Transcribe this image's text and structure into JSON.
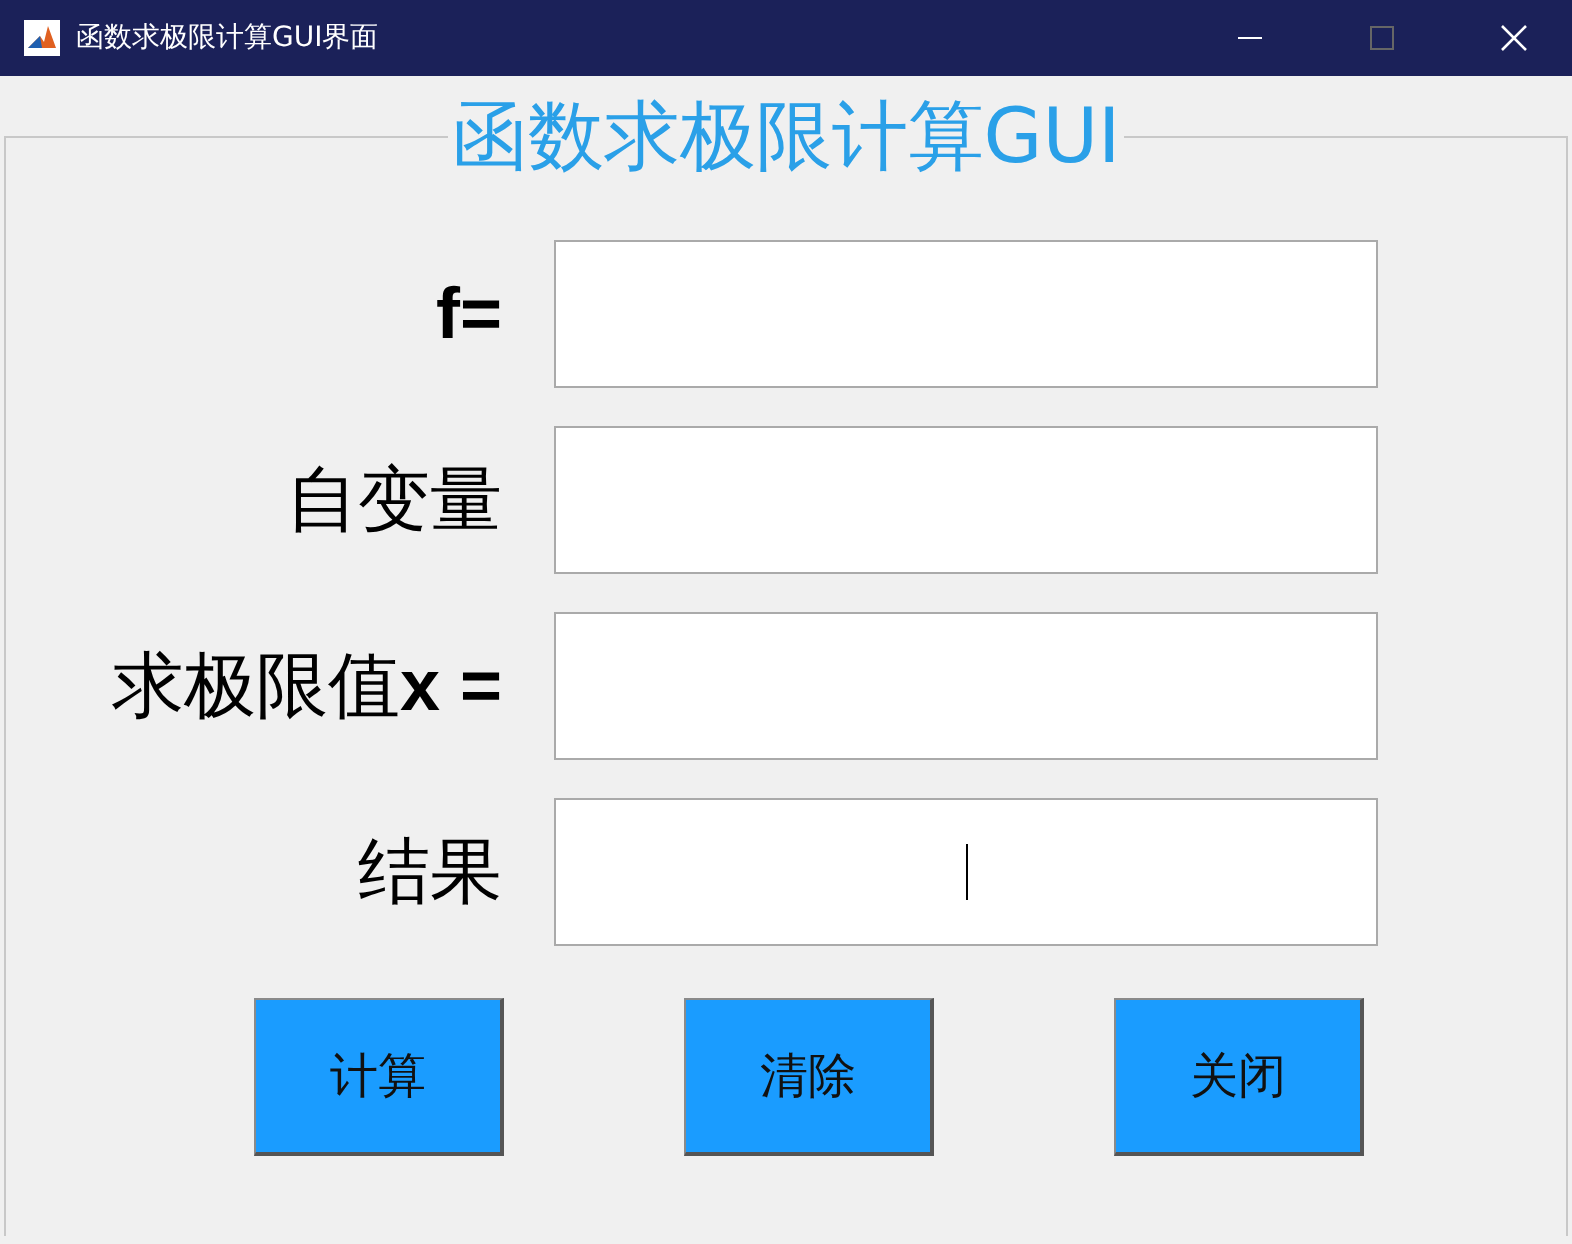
{
  "window": {
    "title": "函数求极限计算GUI界面"
  },
  "panel": {
    "title": "函数求极限计算GUI"
  },
  "fields": [
    {
      "label": "f=",
      "bold": true,
      "focused": false
    },
    {
      "label": "自变量",
      "bold": false,
      "focused": false
    },
    {
      "label": "求极限值**x =**",
      "bold": false,
      "focused": false
    },
    {
      "label": "结果",
      "bold": false,
      "focused": true
    }
  ],
  "buttons": [
    "计算",
    "清除",
    "关闭"
  ]
}
